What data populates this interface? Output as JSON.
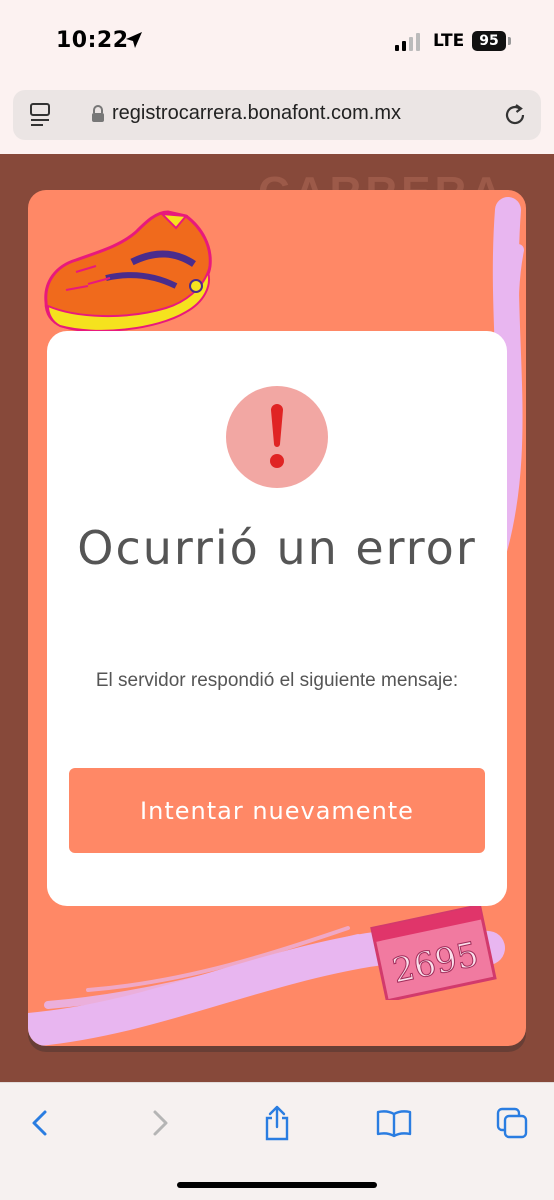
{
  "status_bar": {
    "time": "10:22",
    "network": "LTE",
    "battery": "95"
  },
  "browser": {
    "url": "registrocarrera.bonafont.com.mx"
  },
  "page": {
    "background_heading": "CARRERA",
    "bib_number": "2695",
    "colors": {
      "brand_orange": "#ff8866",
      "page_brown": "#87493a",
      "error_pink": "#f2a7a3",
      "error_red": "#e02424"
    }
  },
  "modal": {
    "icon": "exclamation-icon",
    "title": "Ocurrió un error",
    "message": "El servidor respondió el siguiente mensaje:",
    "retry_label": "Intentar nuevamente"
  },
  "toolbar": {
    "items": [
      "back-icon",
      "forward-icon",
      "share-icon",
      "bookmarks-icon",
      "tabs-icon"
    ]
  }
}
